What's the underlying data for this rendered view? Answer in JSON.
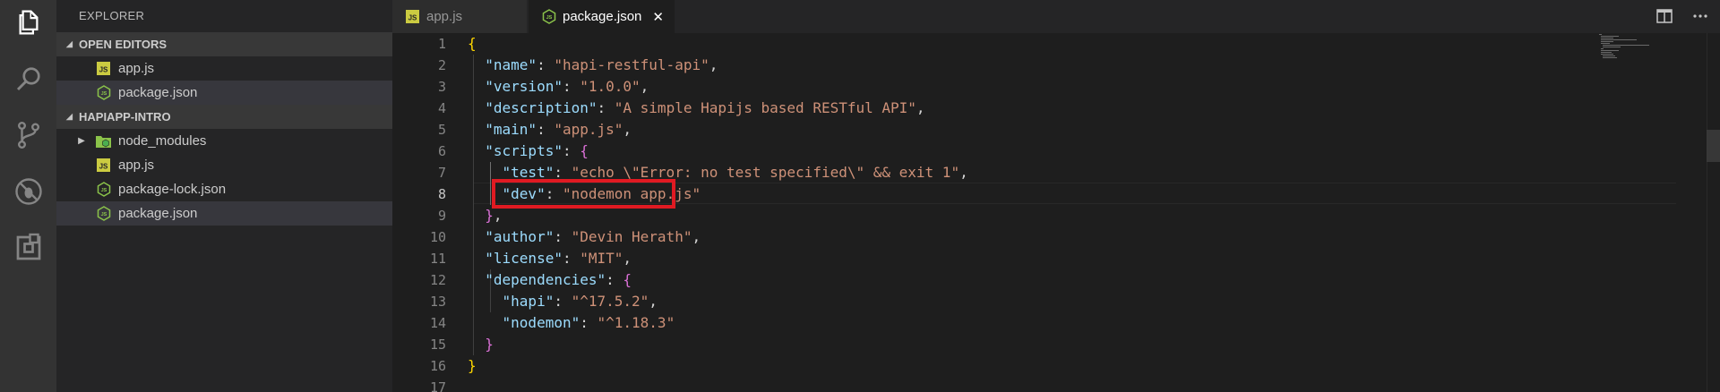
{
  "activity_bar": {
    "icons": [
      "explorer-icon",
      "search-icon",
      "source-control-icon",
      "debug-icon",
      "extensions-icon"
    ]
  },
  "sidebar": {
    "title": "EXPLORER",
    "open_editors": {
      "header": "OPEN EDITORS",
      "items": [
        {
          "label": "app.js",
          "icon": "js-file-icon"
        },
        {
          "label": "package.json",
          "icon": "node-json-file-icon"
        }
      ]
    },
    "project": {
      "header": "HAPIAPP-INTRO",
      "items": [
        {
          "label": "node_modules",
          "icon": "node-folder-icon"
        },
        {
          "label": "app.js",
          "icon": "js-file-icon"
        },
        {
          "label": "package-lock.json",
          "icon": "node-json-file-icon"
        },
        {
          "label": "package.json",
          "icon": "node-json-file-icon"
        }
      ]
    }
  },
  "tabs": [
    {
      "label": "app.js",
      "active": false
    },
    {
      "label": "package.json",
      "active": true,
      "close": "✕"
    }
  ],
  "editor": {
    "active_line": 8,
    "lines": [
      {
        "n": "1"
      },
      {
        "n": "2",
        "key": "\"name\"",
        "val": "\"hapi-restful-api\""
      },
      {
        "n": "3",
        "key": "\"version\"",
        "val": "\"1.0.0\""
      },
      {
        "n": "4",
        "key": "\"description\"",
        "val": "\"A simple Hapijs based RESTful API\""
      },
      {
        "n": "5",
        "key": "\"main\"",
        "val": "\"app.js\""
      },
      {
        "n": "6",
        "key": "\"scripts\""
      },
      {
        "n": "7",
        "key": "\"test\"",
        "val": "\"echo \\\"Error: no test specified\\\" && exit 1\""
      },
      {
        "n": "8",
        "key": "\"dev\"",
        "val": "\"nodemon app.js\""
      },
      {
        "n": "9"
      },
      {
        "n": "10",
        "key": "\"author\"",
        "val": "\"Devin Herath\""
      },
      {
        "n": "11",
        "key": "\"license\"",
        "val": "\"MIT\""
      },
      {
        "n": "12",
        "key": "\"dependencies\""
      },
      {
        "n": "13",
        "key": "\"hapi\"",
        "val": "\"^17.5.2\""
      },
      {
        "n": "14",
        "key": "\"nodemon\"",
        "val": "\"^1.18.3\""
      },
      {
        "n": "15"
      },
      {
        "n": "16"
      },
      {
        "n": "17"
      }
    ]
  },
  "colors": {
    "highlight_box": "#e01a22",
    "key": "#9cdcfe",
    "string": "#ce9178",
    "brace_outer": "#ffd700",
    "brace_inner": "#da70d6"
  }
}
